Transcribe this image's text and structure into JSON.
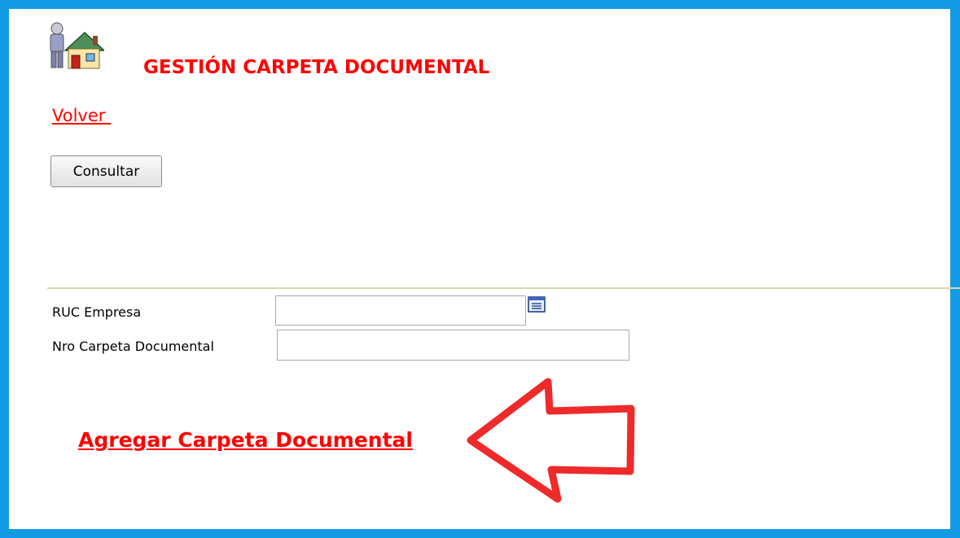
{
  "page": {
    "title": "GESTIÓN CARPETA DOCUMENTAL",
    "back_link": "Volver ",
    "colors": {
      "frame": "#139be3",
      "accent": "#ff0000",
      "divider": "#d8d6b0"
    }
  },
  "toolbar": {
    "consultar_label": "Consultar"
  },
  "form": {
    "ruc_label": "RUC Empresa",
    "ruc_value": "",
    "nro_label": "Nro Carpeta Documental",
    "nro_value": ""
  },
  "actions": {
    "add_label": "Agregar Carpeta Documental"
  },
  "icons": {
    "header": "user-house-icon",
    "lookup": "list-lookup-icon",
    "annotation": "red-arrow-left"
  }
}
